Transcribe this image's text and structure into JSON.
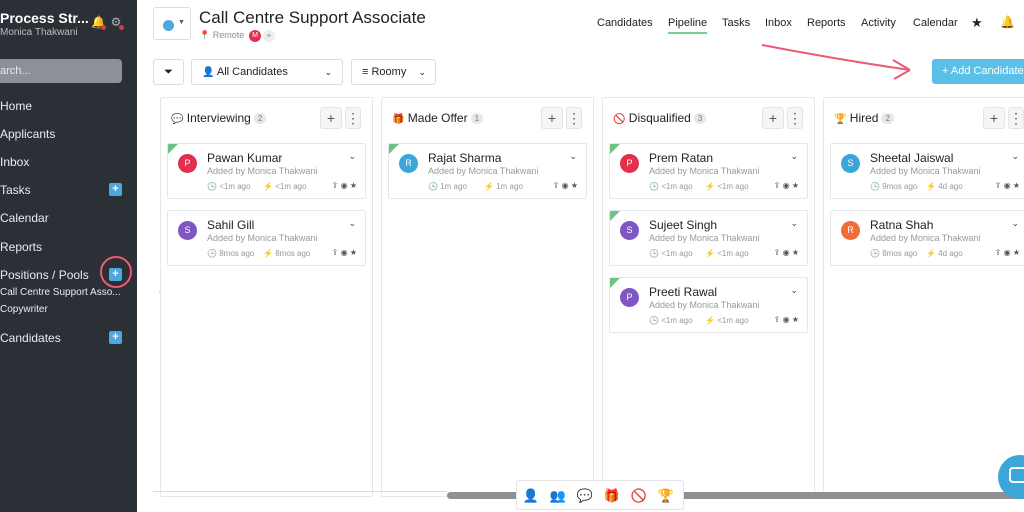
{
  "sidebar": {
    "brand": "Process Str...",
    "user": "Monica Thakwani",
    "search_placeholder": "arch...",
    "items": [
      {
        "label": "Home"
      },
      {
        "label": "Applicants"
      },
      {
        "label": "Inbox"
      },
      {
        "label": "Tasks"
      },
      {
        "label": "Calendar"
      },
      {
        "label": "Reports"
      },
      {
        "label": "Positions / Pools"
      },
      {
        "label": "Call Centre Support Asso..."
      },
      {
        "label": "Copywriter"
      },
      {
        "label": "Candidates"
      }
    ],
    "plus": "+"
  },
  "header": {
    "title": "Call Centre Support Associate",
    "location": "Remote",
    "avatar_letter": "M",
    "add": "+"
  },
  "nav": {
    "items": [
      "Candidates",
      "Pipeline",
      "Tasks",
      "Inbox",
      "Reports",
      "Activity",
      "Calendar"
    ],
    "active": "Pipeline"
  },
  "toolbar": {
    "candidates_filter": "All Candidates",
    "view": "Roomy",
    "add_button": "+ Add Candidate"
  },
  "columns": [
    {
      "title": "Interviewing",
      "count": "2",
      "cards": [
        {
          "letter": "P",
          "name": "Pawan Kumar",
          "added": "Added by Monica Thakwani",
          "t1": "<1m ago",
          "t2": "<1m ago",
          "color": "#e0304e",
          "flag": true
        },
        {
          "letter": "S",
          "name": "Sahil Gill",
          "added": "Added by Monica Thakwani",
          "t1": "8mos ago",
          "t2": "8mos ago",
          "color": "#7e57c2",
          "flag": false
        }
      ]
    },
    {
      "title": "Made Offer",
      "count": "1",
      "cards": [
        {
          "letter": "R",
          "name": "Rajat Sharma",
          "added": "Added by Monica Thakwani",
          "t1": "1m ago",
          "t2": "1m ago",
          "color": "#3aa6d9",
          "flag": true
        }
      ]
    },
    {
      "title": "Disqualified",
      "count": "3",
      "cards": [
        {
          "letter": "P",
          "name": "Prem Ratan",
          "added": "Added by Monica Thakwani",
          "t1": "<1m ago",
          "t2": "<1m ago",
          "color": "#e0304e",
          "flag": true
        },
        {
          "letter": "S",
          "name": "Sujeet Singh",
          "added": "Added by Monica Thakwani",
          "t1": "<1m ago",
          "t2": "<1m ago",
          "color": "#7e57c2",
          "flag": true
        },
        {
          "letter": "P",
          "name": "Preeti Rawal",
          "added": "Added by Monica Thakwani",
          "t1": "<1m ago",
          "t2": "<1m ago",
          "color": "#7e57c2",
          "flag": true
        }
      ]
    },
    {
      "title": "Hired",
      "count": "2",
      "cards": [
        {
          "letter": "S",
          "name": "Sheetal Jaiswal",
          "added": "Added by Monica Thakwani",
          "t1": "9mos ago",
          "t2": "4d ago",
          "color": "#3aa6d9",
          "flag": false
        },
        {
          "letter": "R",
          "name": "Ratna Shah",
          "added": "Added by Monica Thakwani",
          "t1": "8mos ago",
          "t2": "4d ago",
          "color": "#f06d35",
          "flag": false
        }
      ]
    }
  ],
  "colors": {
    "sidebar": "#2b2f36",
    "accent": "#5bc0e8",
    "active_tab": "#7ccf9b",
    "annotation": "#e95a74"
  }
}
